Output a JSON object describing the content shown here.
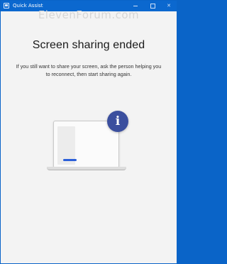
{
  "window": {
    "title": "Quick Assist",
    "controls": {
      "minimize": "minimize",
      "maximize": "maximize",
      "close": "✕"
    }
  },
  "watermark": "ElevenForum.com",
  "main": {
    "heading": "Screen sharing ended",
    "message": "If you still want to share your screen, ask the person helping you to reconnect, then start sharing again.",
    "info_badge": "i"
  },
  "colors": {
    "titlebar": "#0b68cf",
    "badge": "#3b4f9e",
    "accent_bar": "#2b5fd9"
  },
  "icons": {
    "app": "quick-assist-icon",
    "info": "info-icon"
  }
}
